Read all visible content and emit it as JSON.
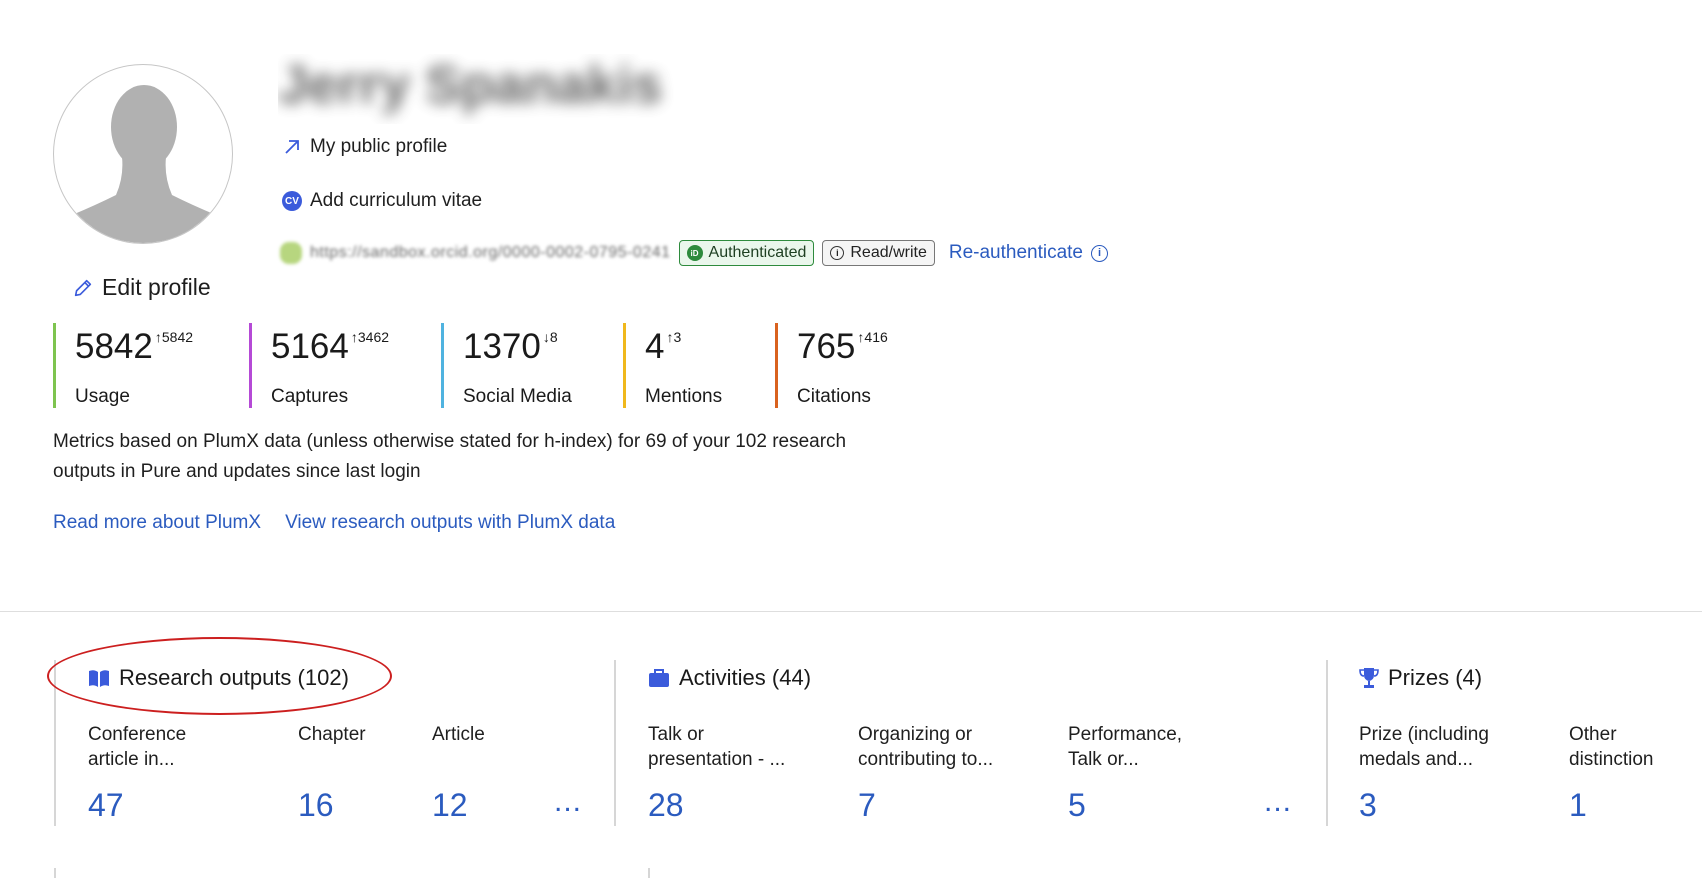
{
  "profile": {
    "name_blurred": "Jerry Spanakis",
    "edit_label": "Edit profile",
    "public_profile_label": "My public profile",
    "cv_label": "Add curriculum vitae",
    "cv_badge": "CV",
    "orcid_url_blurred": "https://sandbox.orcid.org/0000-0002-0795-0241",
    "authenticated_label": "Authenticated",
    "auth_badge_icon": "iD",
    "readwrite_label": "Read/write",
    "reauth_label": "Re-authenticate"
  },
  "metrics": [
    {
      "value": "5842",
      "delta": "↑5842",
      "label": "Usage",
      "color": "#7ec44f"
    },
    {
      "value": "5164",
      "delta": "↑3462",
      "label": "Captures",
      "color": "#b54ad6"
    },
    {
      "value": "1370",
      "delta": "↓8",
      "label": "Social Media",
      "color": "#4fb3e0"
    },
    {
      "value": "4",
      "delta": "↑3",
      "label": "Mentions",
      "color": "#f0b81c"
    },
    {
      "value": "765",
      "delta": "↑416",
      "label": "Citations",
      "color": "#d9621f"
    }
  ],
  "metrics_description": "Metrics based on PlumX data (unless otherwise stated for h-index) for 69 of your 102 research outputs in Pure and updates since last login",
  "plum_links": {
    "read_more": "Read more about PlumX",
    "view_outputs": "View research outputs with PlumX data"
  },
  "sections": {
    "research": {
      "title": "Research outputs (102)",
      "cols": [
        {
          "label1": "Conference",
          "label2": "article in...",
          "value": "47"
        },
        {
          "label1": "Chapter",
          "label2": "",
          "value": "16"
        },
        {
          "label1": "Article",
          "label2": "",
          "value": "12"
        }
      ],
      "more": "..."
    },
    "activities": {
      "title": "Activities (44)",
      "cols": [
        {
          "label1": "Talk or",
          "label2": "presentation - ...",
          "value": "28"
        },
        {
          "label1": "Organizing or",
          "label2": "contributing to...",
          "value": "7"
        },
        {
          "label1": "Performance,",
          "label2": "Talk or...",
          "value": "5"
        }
      ],
      "more": "..."
    },
    "prizes": {
      "title": "Prizes (4)",
      "cols": [
        {
          "label1": "Prize (including",
          "label2": "medals and...",
          "value": "3"
        },
        {
          "label1": "Other",
          "label2": "distinction",
          "value": "1"
        }
      ]
    }
  },
  "colors": {
    "link": "#2b5bbf",
    "icon": "#3b5bdb",
    "annotation": "#cc1f1f"
  }
}
